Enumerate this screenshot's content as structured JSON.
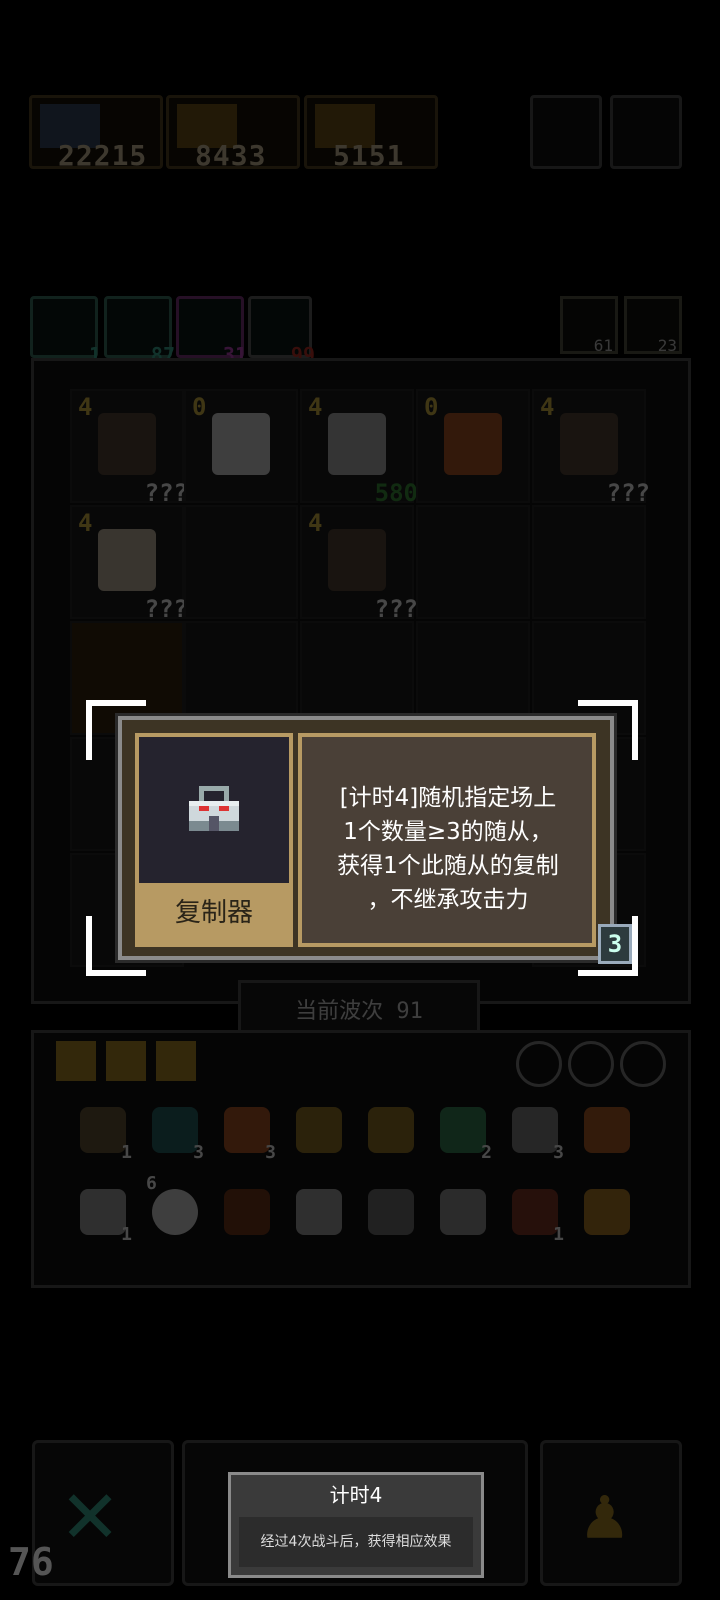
{
  "stats": [
    {
      "value": "22215"
    },
    {
      "value": "8433"
    },
    {
      "value": "5151"
    }
  ],
  "resources": [
    {
      "value": "1",
      "color": "#3fb59a"
    },
    {
      "value": "87",
      "color": "#3fb59a"
    },
    {
      "value": "31",
      "color": "#c44ac4"
    },
    {
      "value": "99",
      "color": "#c8322a"
    }
  ],
  "corner_tiles": [
    {
      "value": "61"
    },
    {
      "value": "23"
    }
  ],
  "board": {
    "cells": [
      {
        "level": "4",
        "badge": "???"
      },
      {
        "level": "0",
        "badge": ""
      },
      {
        "level": "4",
        "badge": "580"
      },
      {
        "level": "0",
        "badge": ""
      },
      {
        "level": "4",
        "badge": "???"
      },
      {
        "level": "4",
        "badge": "???"
      },
      {
        "level": "",
        "badge": ""
      },
      {
        "level": "4",
        "badge": "???"
      },
      {
        "level": "",
        "badge": ""
      },
      {
        "level": "",
        "badge": ""
      }
    ],
    "wave_label": "当前波次 91"
  },
  "inventory": {
    "row1": [
      {
        "icon": "bone-icon",
        "count": "1"
      },
      {
        "icon": "heart-icon",
        "count": "3"
      },
      {
        "icon": "trophy-icon",
        "count": "3"
      },
      {
        "icon": "amulet-icon",
        "count": ""
      },
      {
        "icon": "potion-icon",
        "count": ""
      },
      {
        "icon": "flask-icon",
        "count": "2"
      },
      {
        "icon": "copier-icon",
        "count": "3"
      },
      {
        "icon": "scroll-icon",
        "count": ""
      }
    ],
    "row2": [
      {
        "icon": "stone-icon",
        "count": "1"
      },
      {
        "icon": "spark-icon",
        "count": "6"
      },
      {
        "icon": "chest-icon",
        "count": ""
      },
      {
        "icon": "mask-icon",
        "count": ""
      },
      {
        "icon": "magnet-icon",
        "count": ""
      },
      {
        "icon": "gear-icon",
        "count": ""
      },
      {
        "icon": "horn-icon",
        "count": "1"
      },
      {
        "icon": "claw-icon",
        "count": ""
      }
    ]
  },
  "popup": {
    "item_name": "复制器",
    "description": "[计时4]随机指定场上\n1个数量≥3的随从，\n获得1个此随从的复制\n，不继承攻击力",
    "count": "3"
  },
  "tooltip": {
    "title": "计时4",
    "body": "经过4次战斗后，获得相应效果"
  },
  "page_number": "76",
  "colors": {
    "accent_gold": "#b79a63",
    "popup_bg": "#3d3424",
    "board_bg": "#131313"
  }
}
